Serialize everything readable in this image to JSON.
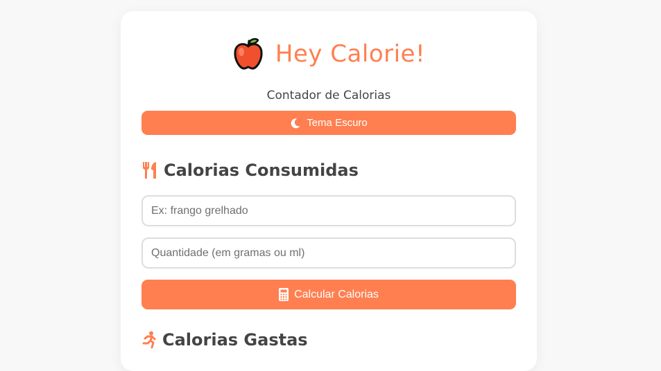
{
  "app": {
    "title": "Hey Calorie!",
    "subtitle": "Contador de Calorias",
    "accent_color": "#ff7f50"
  },
  "theme_toggle": {
    "label": "Tema Escuro",
    "icon": "moon-icon"
  },
  "consumed_section": {
    "title": "Calorias Consumidas",
    "icon": "fork-knife-icon",
    "food_input": {
      "placeholder": "Ex: frango grelhado",
      "value": ""
    },
    "quantity_input": {
      "placeholder": "Quantidade (em gramas ou ml)",
      "value": ""
    },
    "calculate_button": {
      "label": "Calcular Calorias",
      "icon": "calculator-icon"
    }
  },
  "burned_section": {
    "title": "Calorias Gastas",
    "icon": "running-person-icon"
  }
}
